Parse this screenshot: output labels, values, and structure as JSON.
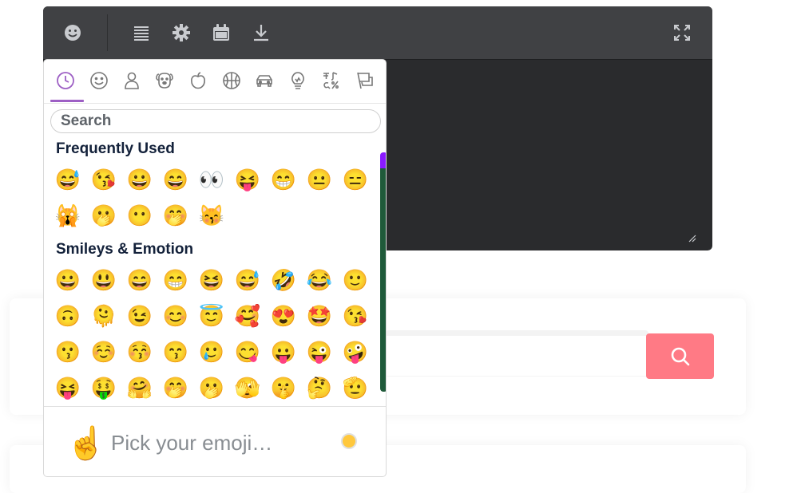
{
  "toolbar": {
    "icons": [
      "smiley-icon",
      "paragraph-icon",
      "gear-icon",
      "calendar-icon",
      "download-icon",
      "fullscreen-icon"
    ]
  },
  "picker": {
    "categories": [
      "recent-icon",
      "smileys-icon",
      "people-icon",
      "animals-icon",
      "food-icon",
      "activities-icon",
      "travel-icon",
      "objects-icon",
      "symbols-icon",
      "flags-icon"
    ],
    "search_placeholder": "Search",
    "sections": [
      {
        "title": "Frequently Used",
        "emojis": [
          "😅",
          "😘",
          "😀",
          "😄",
          "👀",
          "😝",
          "😁",
          "😐",
          "😑",
          "🙀",
          "🫢",
          "😶",
          "🤭",
          "😽"
        ]
      },
      {
        "title": "Smileys & Emotion",
        "emojis": [
          "😀",
          "😃",
          "😄",
          "😁",
          "😆",
          "😅",
          "🤣",
          "😂",
          "🙂",
          "🙃",
          "🫠",
          "😉",
          "😊",
          "😇",
          "🥰",
          "😍",
          "🤩",
          "😘",
          "😗",
          "☺️",
          "😚",
          "😙",
          "🥲",
          "😋",
          "😛",
          "😜",
          "🤪",
          "😝",
          "🤑",
          "🤗",
          "🤭",
          "🫢",
          "🫣",
          "🤫",
          "🤔",
          "🫡"
        ]
      }
    ],
    "preview_emoji": "☝️",
    "preview_text": "Pick your emoji…"
  },
  "colors": {
    "editor_bg": "#2a2b2d",
    "toolbar_bg": "#404144",
    "accent_purple": "#9d5fc4",
    "search_button": "#ff7a85",
    "skin_tone": "#ffc83d"
  }
}
